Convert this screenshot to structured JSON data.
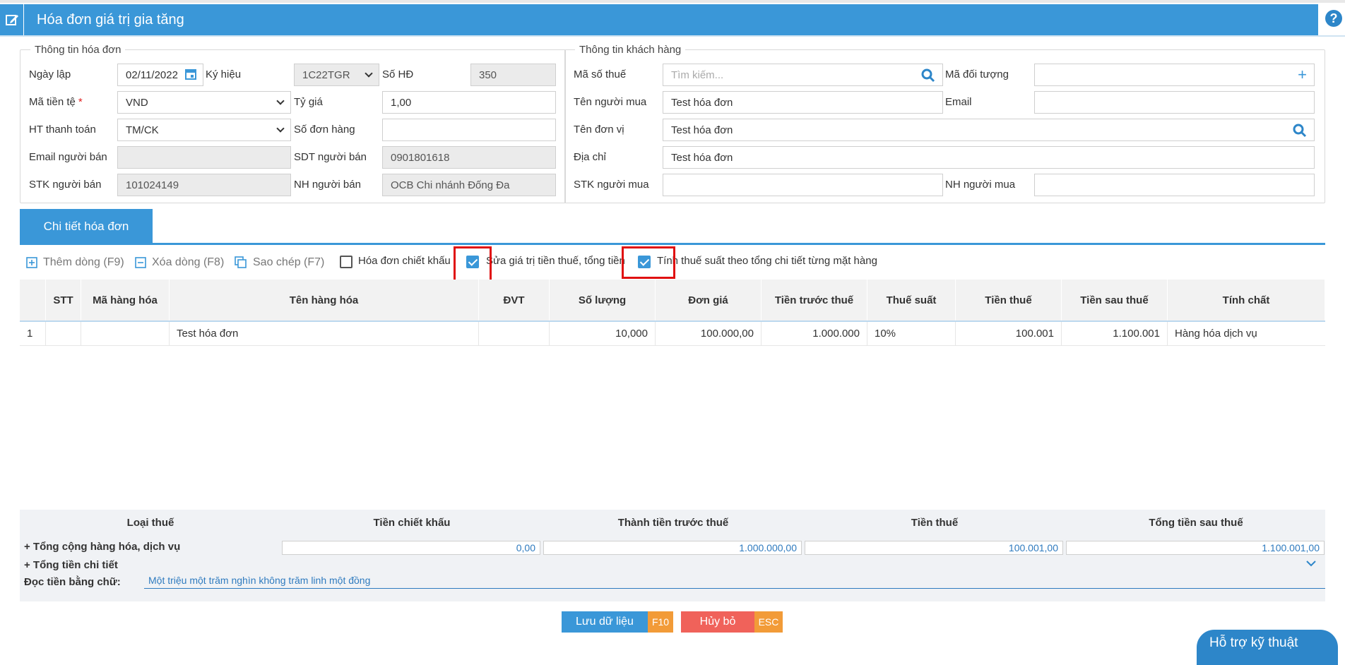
{
  "header": {
    "title": "Hóa đơn giá trị gia tăng",
    "help": "?"
  },
  "invoice_info": {
    "legend": "Thông tin hóa đơn",
    "ngay_lap_label": "Ngày lập",
    "ngay_lap": "02/11/2022",
    "ky_hieu_label": "Ký hiệu",
    "ky_hieu": "1C22TGR",
    "so_hd_label": "Số HĐ",
    "so_hd": "350",
    "ma_tien_te_label": "Mã tiền tệ",
    "required_mark": "*",
    "ma_tien_te": "VND",
    "ty_gia_label": "Tỷ giá",
    "ty_gia": "1,00",
    "ht_thanh_toan_label": "HT thanh toán",
    "ht_thanh_toan": "TM/CK",
    "so_don_hang_label": "Số đơn hàng",
    "so_don_hang": "",
    "email_nguoi_ban_label": "Email người bán",
    "email_nguoi_ban": "",
    "sdt_nguoi_ban_label": "SDT người bán",
    "sdt_nguoi_ban": "0901801618",
    "stk_nguoi_ban_label": "STK người bán",
    "stk_nguoi_ban": "101024149",
    "nh_nguoi_ban_label": "NH người bán",
    "nh_nguoi_ban": "OCB Chi nhánh Đống Đa"
  },
  "customer_info": {
    "legend": "Thông tin khách hàng",
    "ma_so_thue_label": "Mã số thuế",
    "ma_so_thue_placeholder": "Tìm kiếm...",
    "ma_doi_tuong_label": "Mã đối tượng",
    "ma_doi_tuong": "",
    "plus": "+",
    "ten_nguoi_mua_label": "Tên người mua",
    "ten_nguoi_mua": "Test hóa đơn",
    "email_label": "Email",
    "email": "",
    "ten_don_vi_label": "Tên đơn vị",
    "ten_don_vi": "Test hóa đơn",
    "dia_chi_label": "Địa chỉ",
    "dia_chi": "Test hóa đơn",
    "stk_nguoi_mua_label": "STK người mua",
    "stk_nguoi_mua": "",
    "nh_nguoi_mua_label": "NH người mua",
    "nh_nguoi_mua": ""
  },
  "tab": {
    "label": "Chi tiết hóa đơn"
  },
  "toolbar": {
    "add_row": "Thêm dòng (F9)",
    "delete_row": "Xóa dòng (F8)",
    "copy": "Sao chép (F7)",
    "discount_invoice": "Hóa đơn chiết khấu",
    "discount_checked": false,
    "edit_tax": "Sửa giá trị tiền thuế, tổng tiền",
    "edit_tax_checked": true,
    "calc_tax": "Tính thuế suất theo tổng chi tiết từng mặt hàng",
    "calc_tax_checked": true
  },
  "grid": {
    "columns": [
      "STT",
      "Mã hàng hóa",
      "Tên hàng hóa",
      "ĐVT",
      "Số lượng",
      "Đơn giá",
      "Tiền trước thuế",
      "Thuế suất",
      "Tiền thuế",
      "Tiền sau thuế",
      "Tính chất"
    ],
    "rows": [
      [
        "1",
        "",
        "Test hóa đơn",
        "",
        "10,000",
        "100.000,00",
        "1.000.000",
        "10%",
        "100.001",
        "1.100.001",
        "Hàng hóa dịch vụ"
      ]
    ]
  },
  "summary": {
    "headers": [
      "Loại thuế",
      "Tiền chiết khấu",
      "Thành tiền trước thuế",
      "Tiền thuế",
      "Tổng tiền sau thuế"
    ],
    "total_label": "+ Tổng cộng hàng hóa, dịch vụ",
    "total_values": [
      "0,00",
      "1.000.000,00",
      "100.001,00",
      "1.100.001,00"
    ],
    "detail_label": "+ Tổng tiền chi tiết",
    "words_label": "Đọc tiền bằng chữ:",
    "words_value": "Một triệu một trăm nghìn không trăm linh một đồng"
  },
  "buttons": {
    "save": "Lưu dữ liệu",
    "save_key": "F10",
    "cancel": "Hủy bỏ",
    "cancel_key": "ESC"
  },
  "support": {
    "label": "Hỗ trợ kỹ thuật"
  },
  "colors": {
    "accent": "#3a97d8",
    "save": "#3a97d8",
    "save_key": "#f29b38",
    "cancel": "#f0625a",
    "cancel_key": "#f29b38",
    "highlight": "#e01010"
  }
}
